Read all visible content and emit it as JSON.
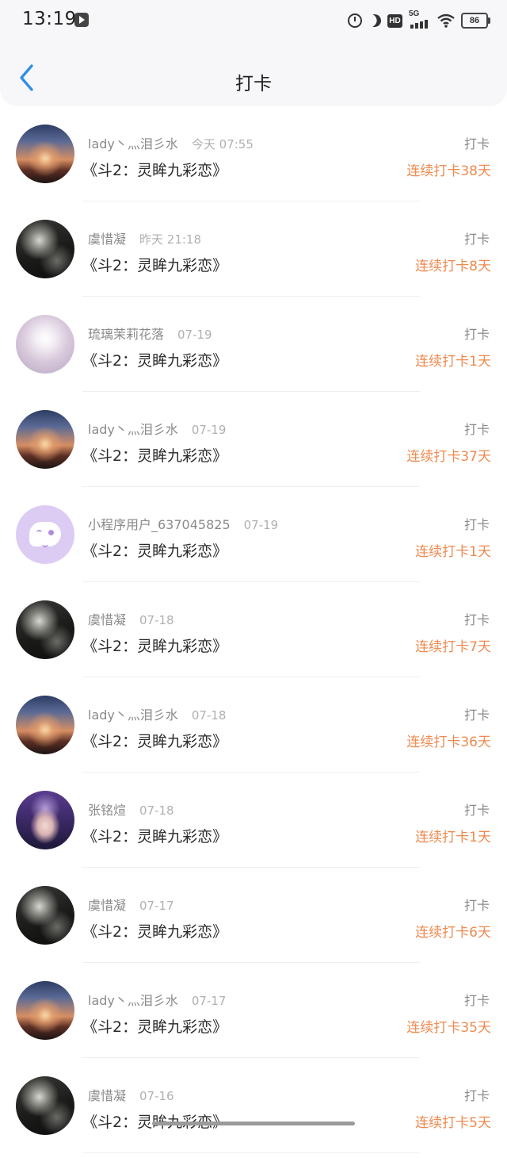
{
  "status_bar": {
    "time": "13:19",
    "network": "5G",
    "hd": "HD",
    "battery": "86",
    "icons": [
      "video-app-icon",
      "alarm-icon",
      "moon-icon",
      "hd-icon",
      "signal-5g-icon",
      "wifi-icon",
      "battery-icon"
    ]
  },
  "header": {
    "title": "打卡",
    "back_icon": "chevron-left-icon",
    "accent_color": "#2f8fe6"
  },
  "colors": {
    "streak": "#ee8a4f",
    "username": "#8a8a8a",
    "time": "#b0b0b0"
  },
  "entries": [
    {
      "avatar": "sunset",
      "username": "lady丶灬泪彡水",
      "time": "今天 07:55",
      "title": "《斗2：灵眸九彩恋》",
      "type": "打卡",
      "streak": "连续打卡38天"
    },
    {
      "avatar": "dark",
      "username": "虞惜凝",
      "time": "昨天 21:18",
      "title": "《斗2：灵眸九彩恋》",
      "type": "打卡",
      "streak": "连续打卡8天"
    },
    {
      "avatar": "pale",
      "username": "琉璃茉莉花落",
      "time": "07-19",
      "title": "《斗2：灵眸九彩恋》",
      "type": "打卡",
      "streak": "连续打卡1天"
    },
    {
      "avatar": "sunset",
      "username": "lady丶灬泪彡水",
      "time": "07-19",
      "title": "《斗2：灵眸九彩恋》",
      "type": "打卡",
      "streak": "连续打卡37天"
    },
    {
      "avatar": "bot",
      "username": "小程序用户_637045825",
      "time": "07-19",
      "title": "《斗2：灵眸九彩恋》",
      "type": "打卡",
      "streak": "连续打卡1天"
    },
    {
      "avatar": "dark",
      "username": "虞惜凝",
      "time": "07-18",
      "title": "《斗2：灵眸九彩恋》",
      "type": "打卡",
      "streak": "连续打卡7天"
    },
    {
      "avatar": "sunset",
      "username": "lady丶灬泪彡水",
      "time": "07-18",
      "title": "《斗2：灵眸九彩恋》",
      "type": "打卡",
      "streak": "连续打卡36天"
    },
    {
      "avatar": "purple",
      "username": "张铭煊",
      "time": "07-18",
      "title": "《斗2：灵眸九彩恋》",
      "type": "打卡",
      "streak": "连续打卡1天"
    },
    {
      "avatar": "dark",
      "username": "虞惜凝",
      "time": "07-17",
      "title": "《斗2：灵眸九彩恋》",
      "type": "打卡",
      "streak": "连续打卡6天"
    },
    {
      "avatar": "sunset",
      "username": "lady丶灬泪彡水",
      "time": "07-17",
      "title": "《斗2：灵眸九彩恋》",
      "type": "打卡",
      "streak": "连续打卡35天"
    },
    {
      "avatar": "dark",
      "username": "虞惜凝",
      "time": "07-16",
      "title": "《斗2：灵眸九彩恋》",
      "type": "打卡",
      "streak": "连续打卡5天"
    }
  ]
}
